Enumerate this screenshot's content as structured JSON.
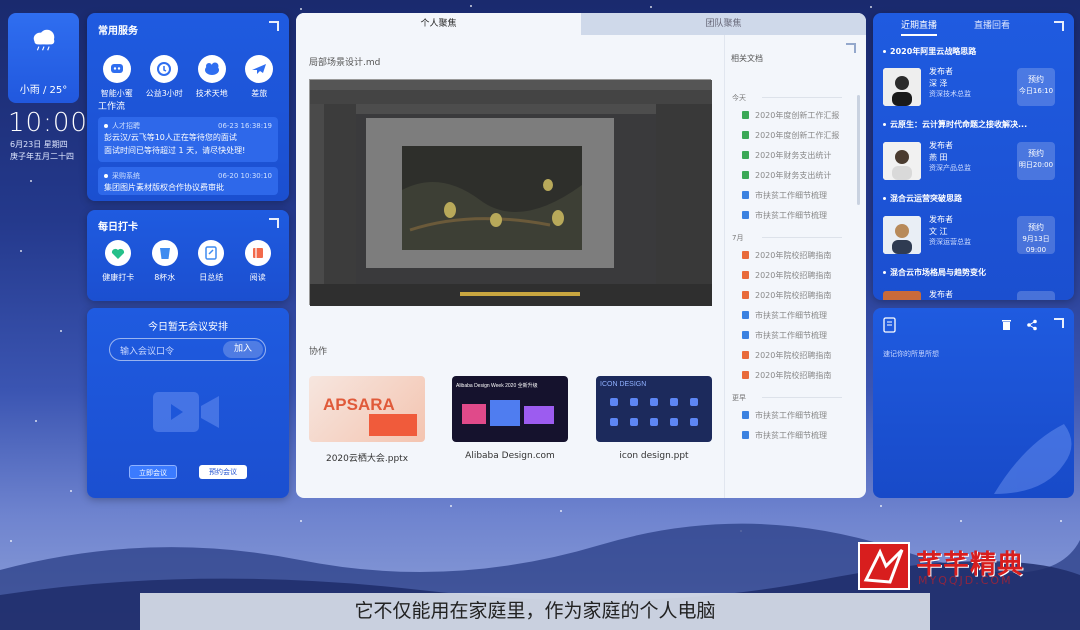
{
  "weather": {
    "text": "小雨 / 25°",
    "icon": "rain-cloud-icon"
  },
  "clock": {
    "time": "10:00",
    "date": "6月23日  星期四",
    "lunar": "庚子年五月二十四"
  },
  "services": {
    "title": "常用服务",
    "items": [
      {
        "label": "智能小蜜",
        "icon": "chat-bot-icon"
      },
      {
        "label": "公益3小时",
        "icon": "charity-icon"
      },
      {
        "label": "技术天地",
        "icon": "tech-icon"
      },
      {
        "label": "差旅",
        "icon": "airplane-icon"
      }
    ],
    "workflow_title": "工作流",
    "workflow": [
      {
        "tag": "人才招聘",
        "time": "06-23 16:38:19",
        "line1": "彭云汉/云飞等10人正在等待您的面试",
        "line2": "面试时间已等待超过 1 天，请尽快处理!"
      },
      {
        "tag": "采购系统",
        "time": "06-20 10:30:10",
        "line1": "集团图片素材版权合作协议费审批",
        "line2": ""
      }
    ]
  },
  "checkin": {
    "title": "每日打卡",
    "items": [
      {
        "label": "健康打卡",
        "icon": "heart-icon"
      },
      {
        "label": "8杯水",
        "icon": "water-cup-icon"
      },
      {
        "label": "日总结",
        "icon": "notebook-icon"
      },
      {
        "label": "阅读",
        "icon": "book-icon"
      }
    ]
  },
  "meeting": {
    "title": "今日暂无会议安排",
    "input_placeholder": "输入会议口令",
    "join_label": "加入",
    "start_now_label": "立即会议",
    "book_label": "预约会议"
  },
  "center": {
    "tabs": [
      "个人聚焦",
      "团队聚焦"
    ],
    "doc_title": "局部场景设计.md",
    "collab_title": "协作",
    "cards": [
      {
        "name": "2020云栖大会.pptx",
        "thumb_text": "APSARA"
      },
      {
        "name": "Alibaba Design.com",
        "thumb_text": "Alibaba Design Week 2020 全新升级"
      },
      {
        "name": "icon design.ppt",
        "thumb_text": "ICON DESIGN"
      }
    ],
    "related": {
      "title": "相关文档",
      "groups": [
        {
          "label": "今天",
          "docs": [
            {
              "name": "2020年度创新工作汇报",
              "color": "#3aa856"
            },
            {
              "name": "2020年度创新工作汇报",
              "color": "#3aa856"
            },
            {
              "name": "2020年财务支出统计",
              "color": "#3aa856"
            },
            {
              "name": "2020年财务支出统计",
              "color": "#3aa856"
            },
            {
              "name": "市扶贫工作细节梳理",
              "color": "#3b82e0"
            },
            {
              "name": "市扶贫工作细节梳理",
              "color": "#3b82e0"
            }
          ]
        },
        {
          "label": "7月",
          "docs": [
            {
              "name": "2020年院校招聘指南",
              "color": "#e86a3a"
            },
            {
              "name": "2020年院校招聘指南",
              "color": "#e86a3a"
            },
            {
              "name": "2020年院校招聘指南",
              "color": "#e86a3a"
            },
            {
              "name": "市扶贫工作细节梳理",
              "color": "#3b82e0"
            },
            {
              "name": "市扶贫工作细节梳理",
              "color": "#3b82e0"
            },
            {
              "name": "2020年院校招聘指南",
              "color": "#e86a3a"
            },
            {
              "name": "2020年院校招聘指南",
              "color": "#e86a3a"
            }
          ]
        },
        {
          "label": "更早",
          "docs": [
            {
              "name": "市扶贫工作细节梳理",
              "color": "#3b82e0"
            },
            {
              "name": "市扶贫工作细节梳理",
              "color": "#3b82e0"
            }
          ]
        }
      ]
    }
  },
  "live": {
    "tabs": [
      "近期直播",
      "直播回看"
    ],
    "items": [
      {
        "topic": "2020年阿里云战略思路",
        "publisher_label": "发布者",
        "name": "深  泽",
        "role": "资深技术总监",
        "btn": "预约",
        "btn_time": "今日16:10"
      },
      {
        "topic": "云原生：云计算时代命题之接收解决...",
        "publisher_label": "发布者",
        "name": "燕  田",
        "role": "资深产品总监",
        "btn": "预约",
        "btn_time": "明日20:00"
      },
      {
        "topic": "混合云运营突破思路",
        "publisher_label": "发布者",
        "name": "文  江",
        "role": "资深运营总监",
        "btn": "预约",
        "btn_time": "9月13日 09:00"
      },
      {
        "topic": "混合云市场格局与趋势变化",
        "publisher_label": "发布者",
        "name": "",
        "role": "",
        "btn": "",
        "btn_time": ""
      }
    ]
  },
  "notes": {
    "placeholder": "速记你的所思所想"
  },
  "subtitle": "它不仅能用在家庭里，作为家庭的个人电脑",
  "watermark": {
    "name": "芊芊精典",
    "url": "MYQQJD.COM"
  },
  "colors": {
    "panel_blue": "#1f5be0",
    "bg_top": "#1a2a6e",
    "logo_red": "#d81e1e"
  }
}
